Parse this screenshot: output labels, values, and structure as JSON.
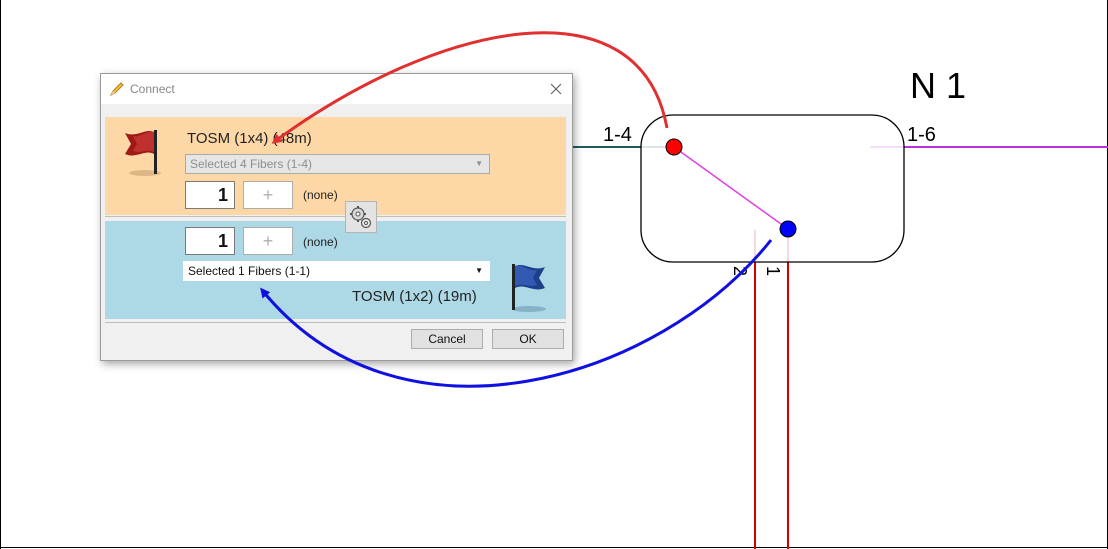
{
  "dialog": {
    "title": "Connect",
    "source": {
      "cable_label": "TOSM (1x4) (48m)",
      "fibers_select": "Selected 4 Fibers (1-4)",
      "count_value": "1",
      "plus_label": "+",
      "none_label": "(none)"
    },
    "destination": {
      "cable_label": "TOSM (1x2) (19m)",
      "fibers_select": "Selected 1 Fibers (1-1)",
      "count_value": "1",
      "plus_label": "+",
      "none_label": "(none)"
    },
    "buttons": {
      "cancel": "Cancel",
      "ok": "OK"
    }
  },
  "diagram": {
    "node_name": "N 1",
    "port_left": "1-4",
    "port_right": "1-6",
    "fiber_label_2": "2",
    "fiber_label_1": "1"
  },
  "colors": {
    "source_panel": "#fdd8a6",
    "destination_panel": "#add8e6",
    "red_connector": "#ff0000",
    "blue_connector": "#0000ff",
    "red_arrow": "#e03030",
    "blue_arrow": "#1010e0",
    "magenta_line": "#e040e0",
    "teal_line": "#1e5e5a",
    "purple_line": "#bb33dd",
    "red_cable": "#d40000"
  }
}
